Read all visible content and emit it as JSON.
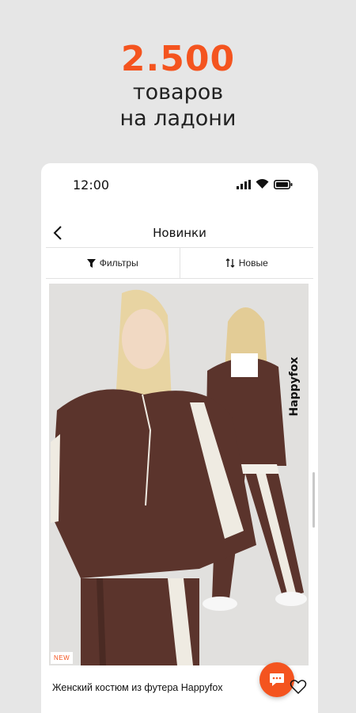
{
  "promo": {
    "number": "2.500",
    "line1": "товаров",
    "line2": "на ладони"
  },
  "status_bar": {
    "time": "12:00",
    "icons": [
      "signal-icon",
      "wifi-icon",
      "battery-icon"
    ]
  },
  "header": {
    "title": "Новинки",
    "back_icon": "chevron-left-icon"
  },
  "filter_bar": {
    "filters_label": "Фильтры",
    "sort_label": "Новые"
  },
  "product": {
    "badge": "NEW",
    "title": "Женский костюм из футера Happyfox",
    "brand_label": "Happyfox"
  },
  "colors": {
    "accent": "#f4541f",
    "background": "#e6e6e6",
    "garment": "#5b342c"
  }
}
